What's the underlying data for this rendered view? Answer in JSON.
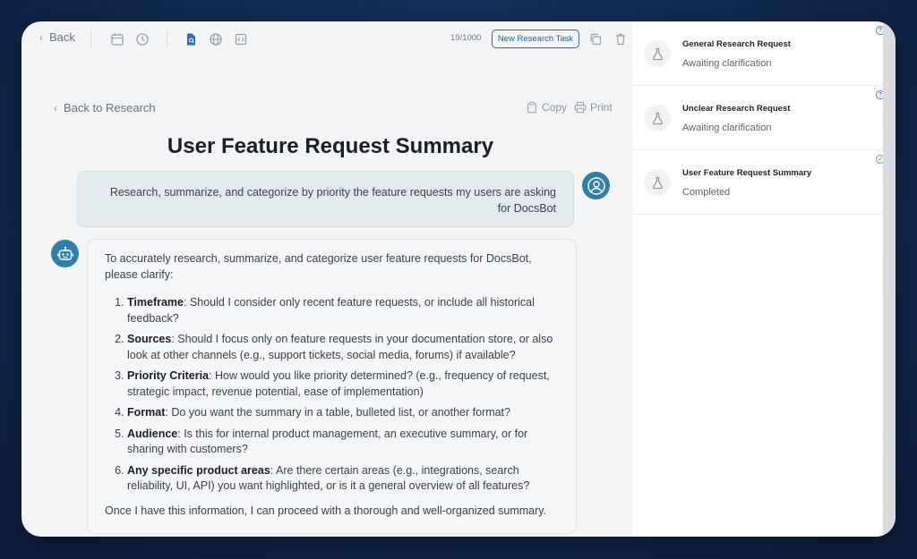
{
  "toolbar": {
    "back_label": "Back",
    "counter": "19/1000",
    "new_task_label": "New Research Task"
  },
  "content": {
    "back_link": "Back to Research",
    "copy_label": "Copy",
    "print_label": "Print",
    "title": "User Feature Request Summary",
    "user_message": "Research, summarize, and categorize by priority the feature requests my users are asking for DocsBot",
    "bot_intro": "To accurately research, summarize, and categorize user feature requests for DocsBot, please clarify:",
    "questions": [
      {
        "term": "Timeframe",
        "text": ": Should I consider only recent feature requests, or include all historical feedback?"
      },
      {
        "term": "Sources",
        "text": ": Should I focus only on feature requests in your documentation store, or also look at other channels (e.g., support tickets, social media, forums) if available?"
      },
      {
        "term": "Priority Criteria",
        "text": ": How would you like priority determined? (e.g., frequency of request, strategic impact, revenue potential, ease of implementation)"
      },
      {
        "term": "Format",
        "text": ": Do you want the summary in a table, bulleted list, or another format?"
      },
      {
        "term": "Audience",
        "text": ": Is this for internal product management, an executive summary, or for sharing with customers?"
      },
      {
        "term": "Any specific product areas",
        "text": ": Are there certain areas (e.g., integrations, search reliability, UI, API) you want highlighted, or is it a general overview of all features?"
      }
    ],
    "bot_outro": "Once I have this information, I can proceed with a thorough and well-organized summary."
  },
  "sidebar": {
    "tasks": [
      {
        "title": "General Research Request",
        "status": "Awaiting clarification",
        "badge": "?"
      },
      {
        "title": "Unclear Research Request",
        "status": "Awaiting clarification",
        "badge": "?"
      },
      {
        "title": "User Feature Request Summary",
        "status": "Completed",
        "badge": "✓"
      }
    ]
  },
  "colors": {
    "accent": "#2f7fa6",
    "button_border": "#2f6db5",
    "pending_badge": "#4a7fd0",
    "done_badge": "#5cb85c"
  }
}
